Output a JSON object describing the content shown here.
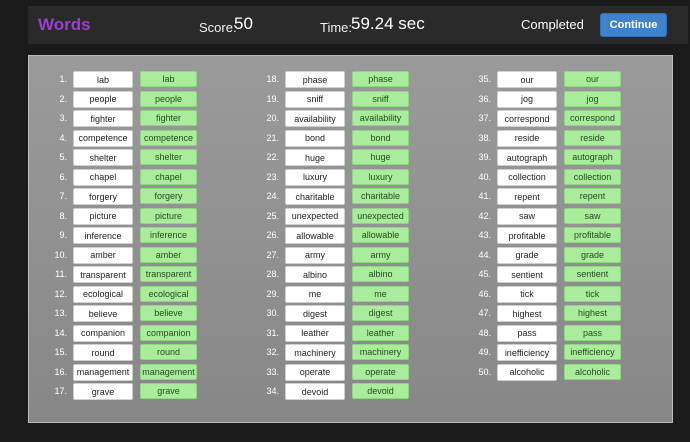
{
  "header": {
    "title": "Words",
    "score_label": "Score:",
    "score_value": "50",
    "time_label": "Time:",
    "time_value": "59.24 sec",
    "status": "Completed",
    "continue_label": "Continue"
  },
  "colors": {
    "title": "#9a3fd1",
    "button": "#3f83cf",
    "correct": "#a8ec9c"
  },
  "columns": [
    [
      {
        "num": "1.",
        "word": "lab",
        "answer": "lab"
      },
      {
        "num": "2.",
        "word": "people",
        "answer": "people"
      },
      {
        "num": "3.",
        "word": "fighter",
        "answer": "fighter"
      },
      {
        "num": "4.",
        "word": "competence",
        "answer": "competence"
      },
      {
        "num": "5.",
        "word": "shelter",
        "answer": "shelter"
      },
      {
        "num": "6.",
        "word": "chapel",
        "answer": "chapel"
      },
      {
        "num": "7.",
        "word": "forgery",
        "answer": "forgery"
      },
      {
        "num": "8.",
        "word": "picture",
        "answer": "picture"
      },
      {
        "num": "9.",
        "word": "inference",
        "answer": "inference"
      },
      {
        "num": "10.",
        "word": "amber",
        "answer": "amber"
      },
      {
        "num": "11.",
        "word": "transparent",
        "answer": "transparent"
      },
      {
        "num": "12.",
        "word": "ecological",
        "answer": "ecological"
      },
      {
        "num": "13.",
        "word": "believe",
        "answer": "believe"
      },
      {
        "num": "14.",
        "word": "companion",
        "answer": "companion"
      },
      {
        "num": "15.",
        "word": "round",
        "answer": "round"
      },
      {
        "num": "16.",
        "word": "management",
        "answer": "management"
      },
      {
        "num": "17.",
        "word": "grave",
        "answer": "grave"
      }
    ],
    [
      {
        "num": "18.",
        "word": "phase",
        "answer": "phase"
      },
      {
        "num": "19.",
        "word": "sniff",
        "answer": "sniff"
      },
      {
        "num": "20.",
        "word": "availability",
        "answer": "availability"
      },
      {
        "num": "21.",
        "word": "bond",
        "answer": "bond"
      },
      {
        "num": "22.",
        "word": "huge",
        "answer": "huge"
      },
      {
        "num": "23.",
        "word": "luxury",
        "answer": "luxury"
      },
      {
        "num": "24.",
        "word": "charitable",
        "answer": "charitable"
      },
      {
        "num": "25.",
        "word": "unexpected",
        "answer": "unexpected"
      },
      {
        "num": "26.",
        "word": "allowable",
        "answer": "allowable"
      },
      {
        "num": "27.",
        "word": "army",
        "answer": "army"
      },
      {
        "num": "28.",
        "word": "albino",
        "answer": "albino"
      },
      {
        "num": "29.",
        "word": "me",
        "answer": "me"
      },
      {
        "num": "30.",
        "word": "digest",
        "answer": "digest"
      },
      {
        "num": "31.",
        "word": "leather",
        "answer": "leather"
      },
      {
        "num": "32.",
        "word": "machinery",
        "answer": "machinery"
      },
      {
        "num": "33.",
        "word": "operate",
        "answer": "operate"
      },
      {
        "num": "34.",
        "word": "devoid",
        "answer": "devoid"
      }
    ],
    [
      {
        "num": "35.",
        "word": "our",
        "answer": "our"
      },
      {
        "num": "36.",
        "word": "jog",
        "answer": "jog"
      },
      {
        "num": "37.",
        "word": "correspond",
        "answer": "correspond"
      },
      {
        "num": "38.",
        "word": "reside",
        "answer": "reside"
      },
      {
        "num": "39.",
        "word": "autograph",
        "answer": "autograph"
      },
      {
        "num": "40.",
        "word": "collection",
        "answer": "collection"
      },
      {
        "num": "41.",
        "word": "repent",
        "answer": "repent"
      },
      {
        "num": "42.",
        "word": "saw",
        "answer": "saw"
      },
      {
        "num": "43.",
        "word": "profitable",
        "answer": "profitable"
      },
      {
        "num": "44.",
        "word": "grade",
        "answer": "grade"
      },
      {
        "num": "45.",
        "word": "sentient",
        "answer": "sentient"
      },
      {
        "num": "46.",
        "word": "tick",
        "answer": "tick"
      },
      {
        "num": "47.",
        "word": "highest",
        "answer": "highest"
      },
      {
        "num": "48.",
        "word": "pass",
        "answer": "pass"
      },
      {
        "num": "49.",
        "word": "inefficiency",
        "answer": "inefficiency"
      },
      {
        "num": "50.",
        "word": "alcoholic",
        "answer": "alcoholic"
      }
    ]
  ]
}
